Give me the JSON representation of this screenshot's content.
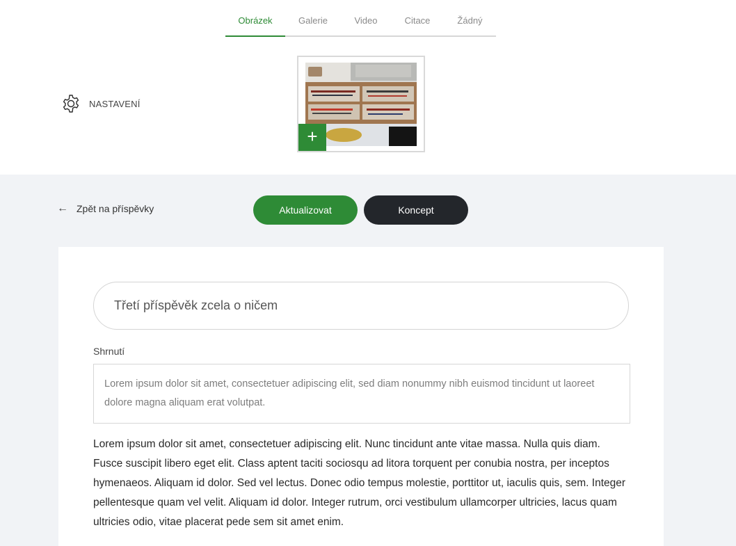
{
  "tabs": [
    "Obrázek",
    "Galerie",
    "Video",
    "Citace",
    "Žádný"
  ],
  "active_tab": "Obrázek",
  "settings": {
    "label": "NASTAVENÍ",
    "icon": "gear-icon"
  },
  "media": {
    "add_label": "+",
    "icon": "plus-icon"
  },
  "actions": {
    "back_arrow": "←",
    "back_label": "Zpět na příspěvky",
    "update_label": "Aktualizovat",
    "draft_label": "Koncept"
  },
  "post": {
    "title": "Třetí příspěvěk zcela o ničem",
    "summary_label": "Shrnutí",
    "summary": "Lorem ipsum dolor sit amet, consectetuer adipiscing elit, sed diam nonummy nibh euismod tincidunt ut laoreet dolore magna aliquam erat volutpat.",
    "body": "Lorem ipsum dolor sit amet, consectetuer adipiscing elit. Nunc tincidunt ante vitae massa. Nulla quis diam. Fusce suscipit libero eget elit. Class aptent taciti sociosqu ad litora torquent per conubia nostra, per inceptos hymenaeos. Aliquam id dolor. Sed vel lectus. Donec odio tempus molestie, porttitor ut, iaculis quis, sem. Integer pellentesque quam vel velit. Aliquam id dolor. Integer rutrum, orci vestibulum ullamcorper ultricies, lacus quam ultricies odio, vitae placerat pede sem sit amet enim."
  },
  "colors": {
    "accent": "#2e8b36",
    "dark": "#23262b",
    "page_bg": "#f1f3f6"
  }
}
